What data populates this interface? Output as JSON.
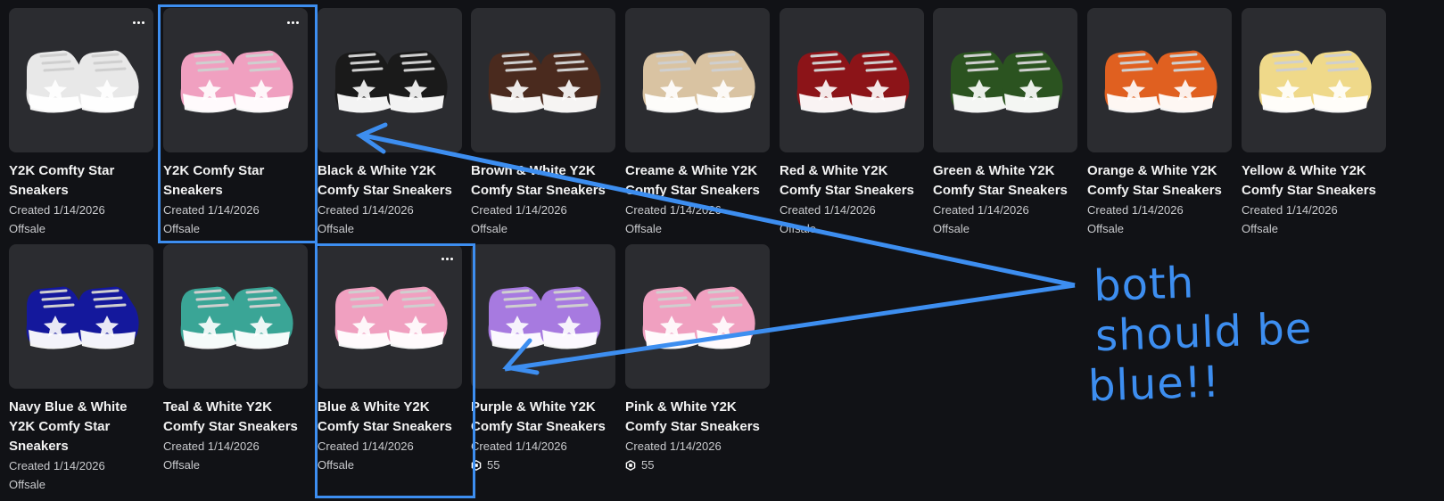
{
  "items": [
    {
      "name": "Y2K Comfty Star Sneakers",
      "created": "Created 1/14/2026",
      "status": "Offsale",
      "price": null,
      "color": "#e8e8e8",
      "accent": "#ffffff",
      "menu": true
    },
    {
      "name": "Y2K Comfy Star Sneakers",
      "created": "Created 1/14/2026",
      "status": "Offsale",
      "price": null,
      "color": "#f0a0c0",
      "accent": "#ffffff",
      "menu": true
    },
    {
      "name": "Black & White Y2K Comfy Star Sneakers",
      "created": "Created 1/14/2026",
      "status": "Offsale",
      "price": null,
      "color": "#1a1a1a",
      "accent": "#ffffff",
      "menu": false
    },
    {
      "name": "Brown & White Y2K Comfy Star Sneakers",
      "created": "Created 1/14/2026",
      "status": "Offsale",
      "price": null,
      "color": "#4a2a1e",
      "accent": "#ffffff",
      "menu": false
    },
    {
      "name": "Creame & White Y2K Comfy Star Sneakers",
      "created": "Created 1/14/2026",
      "status": "Offsale",
      "price": null,
      "color": "#d9c3a2",
      "accent": "#ffffff",
      "menu": false
    },
    {
      "name": "Red & White Y2K Comfy Star Sneakers",
      "created": "Created 1/14/2026",
      "status": "Offsale",
      "price": null,
      "color": "#8c1418",
      "accent": "#ffffff",
      "menu": false
    },
    {
      "name": "Green & White Y2K Comfy Star Sneakers",
      "created": "Created 1/14/2026",
      "status": "Offsale",
      "price": null,
      "color": "#2b5320",
      "accent": "#ffffff",
      "menu": false
    },
    {
      "name": "Orange & White Y2K Comfy Star Sneakers",
      "created": "Created 1/14/2026",
      "status": "Offsale",
      "price": null,
      "color": "#e06020",
      "accent": "#ffffff",
      "menu": false
    },
    {
      "name": "Yellow & White Y2K Comfy Star Sneakers",
      "created": "Created 1/14/2026",
      "status": "Offsale",
      "price": null,
      "color": "#efd98a",
      "accent": "#ffffff",
      "menu": false
    },
    {
      "name": "Navy Blue & White Y2K Comfy Star Sneakers",
      "created": "Created 1/14/2026",
      "status": "Offsale",
      "price": null,
      "color": "#14189c",
      "accent": "#ffffff",
      "menu": false
    },
    {
      "name": "Teal & White Y2K Comfy Star Sneakers",
      "created": "Created 1/14/2026",
      "status": "Offsale",
      "price": null,
      "color": "#3aa596",
      "accent": "#ffffff",
      "menu": false
    },
    {
      "name": "Blue & White Y2K Comfy Star Sneakers",
      "created": "Created 1/14/2026",
      "status": "Offsale",
      "price": null,
      "color": "#f0a0c0",
      "accent": "#ffffff",
      "menu": true
    },
    {
      "name": "Purple & White Y2K Comfy Star Sneakers",
      "created": "Created 1/14/2026",
      "status": null,
      "price": "55",
      "color": "#a77ae0",
      "accent": "#ffffff",
      "menu": false
    },
    {
      "name": "Pink & White Y2K Comfy Star Sneakers",
      "created": "Created 1/14/2026",
      "status": null,
      "price": "55",
      "color": "#f0a0c0",
      "accent": "#ffffff",
      "menu": false
    }
  ],
  "annotation": {
    "lines": [
      "both",
      "should be",
      "blue!!"
    ],
    "color": "#3d8ef0"
  },
  "icons": {
    "menu": "ellipsis-icon",
    "currency": "robux-icon"
  }
}
